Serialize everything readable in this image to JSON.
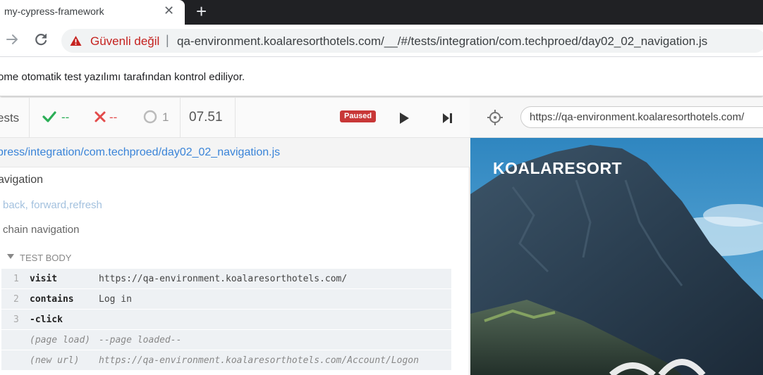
{
  "browser": {
    "tab_title": "my-cypress-framework",
    "not_secure_label": "Güvenli değil",
    "separator": "|",
    "url": "qa-environment.koalaresorthotels.com/__/#/tests/integration/com.techproed/day02_02_navigation.js"
  },
  "infobar": {
    "text": "ome otomatik test yazılımı tarafından kontrol ediliyor."
  },
  "reporter": {
    "tests_label": "ests",
    "passed": "--",
    "failed": "--",
    "pending": "1",
    "duration": "07.51",
    "status_badge": "Paused",
    "spec_path": "press/integration/com.techproed/day02_02_navigation.js",
    "suite_title": "avigation",
    "tests": [
      "back, forward,refresh",
      "chain navigation"
    ],
    "test_body_label": "TEST BODY",
    "commands": [
      {
        "num": "1",
        "name": "visit",
        "message": "https://qa-environment.koalaresorthotels.com/"
      },
      {
        "num": "2",
        "name": "contains",
        "message": "Log in"
      },
      {
        "num": "3",
        "name": "-click",
        "message": ""
      },
      {
        "num": "",
        "name": "(page load)",
        "message": "--page loaded--"
      },
      {
        "num": "",
        "name": "(new url)",
        "message": "https://qa-environment.koalaresorthotels.com/Account/Logon"
      }
    ]
  },
  "aut": {
    "url": "https://qa-environment.koalaresorthotels.com/",
    "brand": "KOALARESORT"
  },
  "colors": {
    "passed": "#2bae56",
    "failed": "#e34b4b",
    "paused": "#c83737",
    "link": "#3a84d8",
    "not_secure": "#c5221f"
  }
}
